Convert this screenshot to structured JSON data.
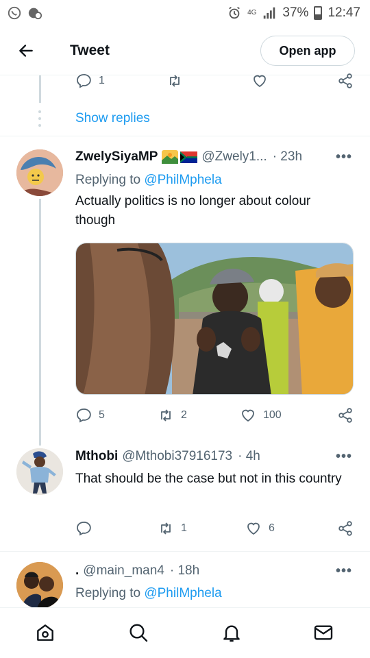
{
  "status_bar": {
    "network": "4G",
    "battery": "37%",
    "time": "12:47"
  },
  "header": {
    "title": "Tweet",
    "open_app_label": "Open app"
  },
  "top_actions": {
    "reply_count": "1"
  },
  "show_replies_label": "Show replies",
  "tweets": [
    {
      "name": "ZwelySiyaMP",
      "handle": "@Zwely1...",
      "time": "· 23h",
      "replying_prefix": "Replying to ",
      "replying_to": "@PhilMphela",
      "text": "Actually politics is no longer about colour though",
      "replies": "5",
      "retweets": "2",
      "likes": "100"
    },
    {
      "name": "Mthobi",
      "handle": "@Mthobi37916173",
      "time": "· 4h",
      "text": "That should be the case but not in this country",
      "replies": "",
      "retweets": "1",
      "likes": "6"
    },
    {
      "name": ".",
      "handle": "@main_man4",
      "time": "· 18h",
      "replying_prefix": "Replying to ",
      "replying_to": "@PhilMphela"
    }
  ],
  "icons": {
    "back": "arrow-left-icon",
    "reply": "reply-icon",
    "retweet": "retweet-icon",
    "like": "heart-icon",
    "share": "share-icon",
    "more": "more-icon",
    "home": "home-icon",
    "search": "search-icon",
    "notifications": "bell-icon",
    "messages": "mail-icon"
  },
  "colors": {
    "accent": "#1d9bf0",
    "secondary_text": "#536471"
  }
}
